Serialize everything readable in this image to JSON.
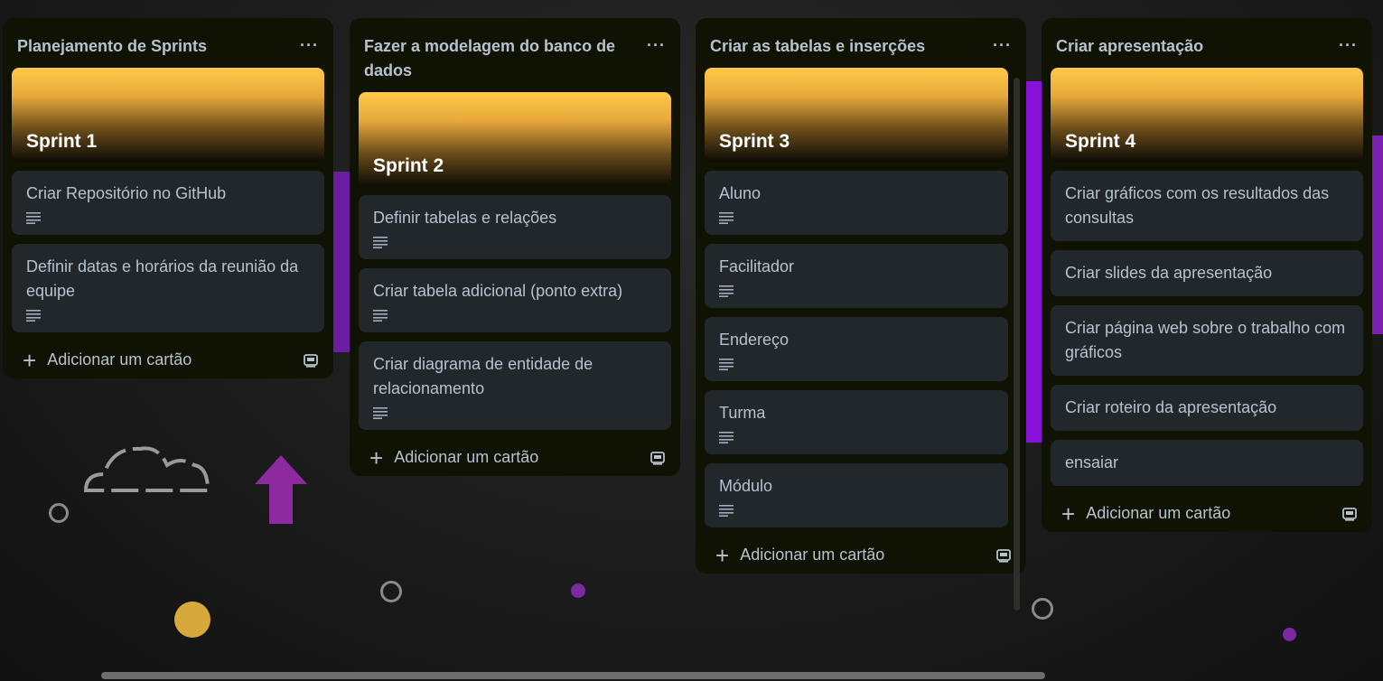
{
  "board": {
    "lists": [
      {
        "title": "Planejamento de Sprints",
        "more_label": "···",
        "cover_title": "Sprint 1",
        "cards": [
          {
            "title": "Criar Repositório no GitHub",
            "has_description": true
          },
          {
            "title": "Definir datas e horários da reunião da equipe",
            "has_description": true
          }
        ],
        "add_label": "Adicionar um cartão"
      },
      {
        "title": "Fazer a modelagem do banco de dados",
        "more_label": "···",
        "cover_title": "Sprint 2",
        "cards": [
          {
            "title": "Definir tabelas e relações",
            "has_description": true
          },
          {
            "title": "Criar tabela adicional (ponto extra)",
            "has_description": true
          },
          {
            "title": "Criar diagrama de entidade de relacionamento",
            "has_description": true
          }
        ],
        "add_label": "Adicionar um cartão"
      },
      {
        "title": "Criar as tabelas e inserções",
        "more_label": "···",
        "cover_title": "Sprint 3",
        "cards": [
          {
            "title": "Aluno",
            "has_description": true
          },
          {
            "title": "Facilitador",
            "has_description": true
          },
          {
            "title": "Endereço",
            "has_description": true
          },
          {
            "title": "Turma",
            "has_description": true
          },
          {
            "title": "Módulo",
            "has_description": true
          }
        ],
        "add_label": "Adicionar um cartão"
      },
      {
        "title": "Criar apresentação",
        "more_label": "···",
        "cover_title": "Sprint 4",
        "cards": [
          {
            "title": "Criar gráficos com os resultados das consultas",
            "has_description": false
          },
          {
            "title": "Criar slides da apresentação",
            "has_description": false
          },
          {
            "title": "Criar página web sobre o trabalho com gráficos",
            "has_description": false
          },
          {
            "title": "Criar roteiro da apresentação",
            "has_description": false
          },
          {
            "title": "ensaiar",
            "has_description": false
          }
        ],
        "add_label": "Adicionar um cartão"
      }
    ]
  },
  "icons": {
    "more": "more-horizontal-icon",
    "description": "description-lines-icon",
    "add": "plus-icon",
    "template": "card-template-icon"
  },
  "colors": {
    "list_bg": "#101204",
    "card_bg": "#22272b",
    "text": "#b6c2cf",
    "cover_gradient_top": "#ffc94a"
  }
}
